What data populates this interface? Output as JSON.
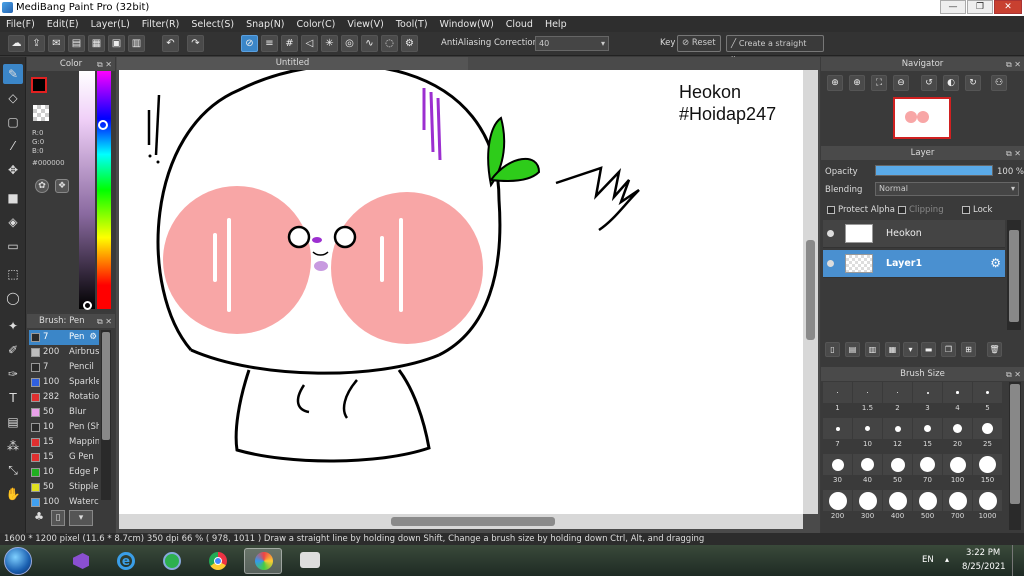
{
  "window": {
    "title": "MediBang Paint Pro (32bit)"
  },
  "menu": [
    "File(F)",
    "Edit(E)",
    "Layer(L)",
    "Filter(R)",
    "Select(S)",
    "Snap(N)",
    "Color(C)",
    "View(V)",
    "Tool(T)",
    "Window(W)",
    "Cloud",
    "Help"
  ],
  "toolbar": {
    "antialiasing_label": "AntiAliasing",
    "correction_label": "Correction",
    "correction_value": "40",
    "key_label": "Key",
    "reset_label": "Reset",
    "straight_line_label": "Create a straight line"
  },
  "document": {
    "tab_title": "Untitled"
  },
  "color_panel": {
    "title": "Color",
    "r": "R:0",
    "g": "G:0",
    "b": "B:0",
    "hex": "#000000",
    "primary_color": "#000000"
  },
  "brush_panel": {
    "title": "Brush: Pen",
    "brushes": [
      {
        "size": "7",
        "name": "Pen",
        "color": "#2a2a2a"
      },
      {
        "size": "200",
        "name": "Airbrush",
        "color": "#bdbdbd"
      },
      {
        "size": "7",
        "name": "Pencil",
        "color": "#2a2a2a"
      },
      {
        "size": "100",
        "name": "Sparkle",
        "color": "#3060e0"
      },
      {
        "size": "282",
        "name": "Rotation",
        "color": "#e03030"
      },
      {
        "size": "50",
        "name": "Blur",
        "color": "#e9a0e9"
      },
      {
        "size": "10",
        "name": "Pen (Sh",
        "color": "#2a2a2a"
      },
      {
        "size": "15",
        "name": "Mapping",
        "color": "#e03030"
      },
      {
        "size": "15",
        "name": "G Pen",
        "color": "#e03030"
      },
      {
        "size": "10",
        "name": "Edge P",
        "color": "#20b020"
      },
      {
        "size": "50",
        "name": "Stipple",
        "color": "#e0e020"
      },
      {
        "size": "100",
        "name": "Waterc",
        "color": "#40a0f0"
      }
    ]
  },
  "canvas_text": {
    "line1": "Heokon",
    "line2": "#Hoidap247"
  },
  "navigator": {
    "title": "Navigator"
  },
  "layer_panel": {
    "title": "Layer",
    "opacity_label": "Opacity",
    "opacity_value": "100 %",
    "opacity_fraction": 1.0,
    "blending_label": "Blending",
    "blending_value": "Normal",
    "protect_alpha": "Protect Alpha",
    "clipping": "Clipping",
    "lock": "Lock",
    "layers": [
      {
        "name": "Heokon",
        "selected": false
      },
      {
        "name": "Layer1",
        "selected": true
      }
    ]
  },
  "brush_size_panel": {
    "title": "Brush Size",
    "sizes": [
      "1",
      "1.5",
      "2",
      "3",
      "4",
      "5",
      "7",
      "10",
      "12",
      "15",
      "20",
      "25",
      "30",
      "40",
      "50",
      "70",
      "100",
      "150",
      "200",
      "300",
      "400",
      "500",
      "700",
      "1000"
    ]
  },
  "status": {
    "text": "1600 * 1200 pixel  (11.6 * 8.7cm)  350 dpi  66 %  ( 978, 1011 )  Draw a straight line by holding down Shift, Change a brush size by holding down Ctrl, Alt, and dragging"
  },
  "taskbar": {
    "language": "EN",
    "time": "3:22 PM",
    "date": "8/25/2021"
  }
}
